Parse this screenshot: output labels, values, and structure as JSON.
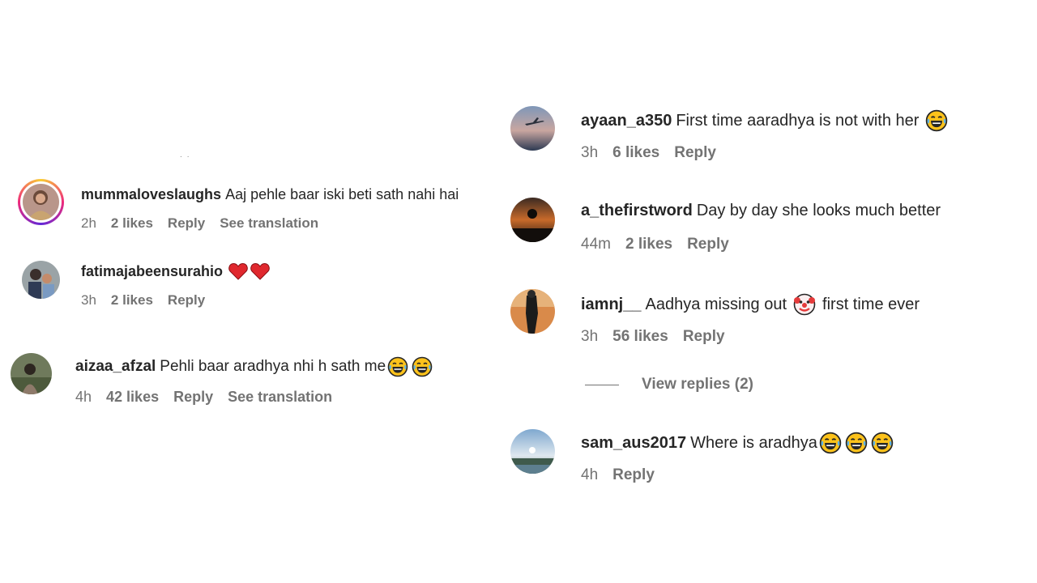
{
  "comments": [
    {
      "username": "mummaloveslaughs",
      "text": "Aaj pehle baar iski beti sath nahi hai",
      "time": "2h",
      "likes": "2 likes",
      "reply": "Reply",
      "translation": "See translation"
    },
    {
      "username": "fatimajabeensurahio",
      "text": "",
      "time": "3h",
      "likes": "2 likes",
      "reply": "Reply"
    },
    {
      "username": "aizaa_afzal",
      "text": "Pehli baar aradhya nhi h sath me",
      "time": "4h",
      "likes": "42 likes",
      "reply": "Reply",
      "translation": "See translation"
    },
    {
      "username": "ayaan_a350",
      "text": "First time aaradhya is not with her",
      "time": "3h",
      "likes": "6 likes",
      "reply": "Reply"
    },
    {
      "username": "a_thefirstword",
      "text": "Day by day she looks much better",
      "time": "44m",
      "likes": "2 likes",
      "reply": "Reply"
    },
    {
      "username": "iamnj__",
      "text": "Aadhya missing out",
      "text_after": "first time ever",
      "time": "3h",
      "likes": "56 likes",
      "reply": "Reply",
      "view_replies": "View replies (2)"
    },
    {
      "username": "sam_aus2017",
      "text": "Where is aradhya",
      "time": "4h",
      "reply": "Reply"
    }
  ],
  "icons": {
    "heart": "red-heart-icon",
    "laugh": "tears-of-joy-emoji-icon",
    "clown": "clown-face-emoji-icon"
  },
  "colors": {
    "text": "#262626",
    "meta": "#737373",
    "heart": "#e0282e"
  }
}
